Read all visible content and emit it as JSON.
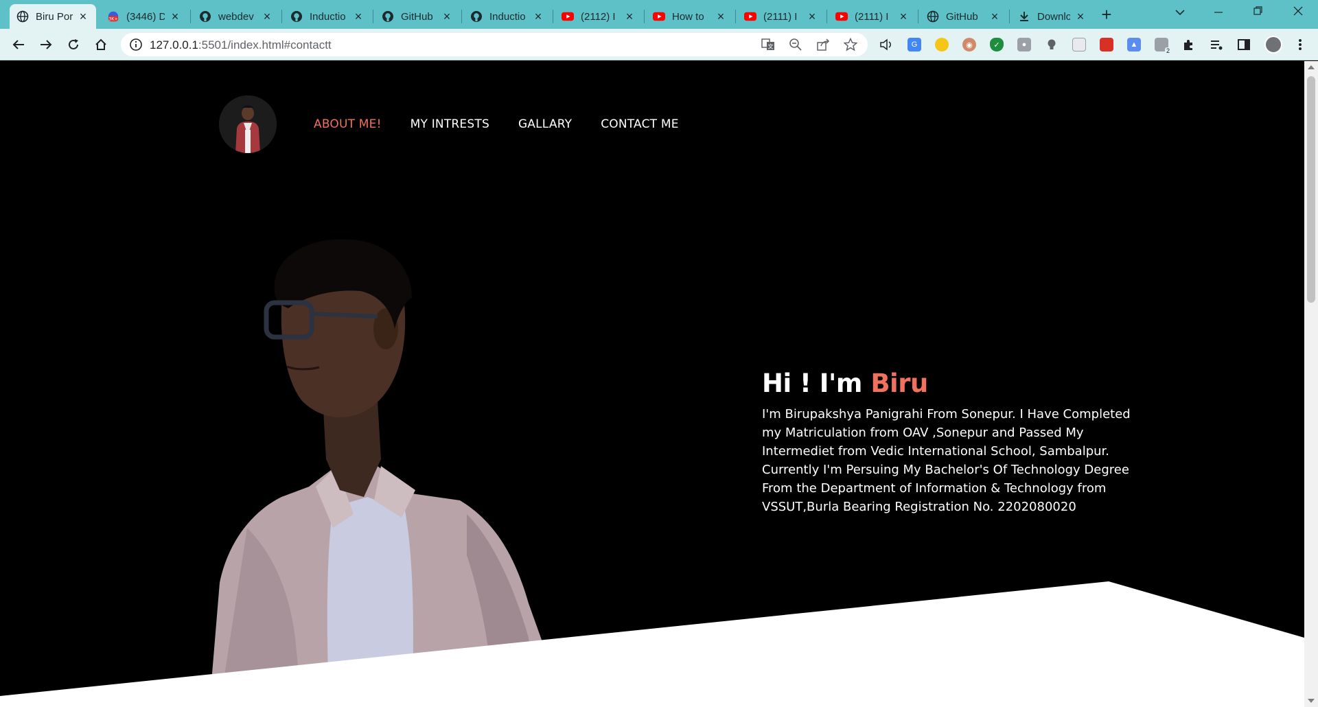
{
  "browser": {
    "tabs": [
      {
        "title": "Biru Por",
        "favicon": "globe-icon",
        "active": true
      },
      {
        "title": "(3446) D",
        "favicon": "notification-badge-icon",
        "badge": "3K+"
      },
      {
        "title": "webdev",
        "favicon": "github-icon"
      },
      {
        "title": "Inductio",
        "favicon": "github-icon"
      },
      {
        "title": "GitHub",
        "favicon": "github-icon"
      },
      {
        "title": "Inductio",
        "favicon": "github-icon"
      },
      {
        "title": "(2112) I",
        "favicon": "youtube-icon"
      },
      {
        "title": "How to",
        "favicon": "youtube-icon"
      },
      {
        "title": "(2111) I",
        "favicon": "youtube-icon"
      },
      {
        "title": "(2111) I",
        "favicon": "youtube-icon"
      },
      {
        "title": "GitHub",
        "favicon": "globe-icon"
      },
      {
        "title": "Downlo",
        "favicon": "download-icon"
      }
    ],
    "url_host": "127.0.0.1",
    "url_rest": ":5501/index.html#contactt",
    "extension_badge": "2",
    "colors": {
      "tabstrip": "#5fc1c8",
      "toolbar": "#e3f3f4",
      "accent": "#f2715c"
    }
  },
  "site": {
    "nav": [
      {
        "label": "ABOUT ME!",
        "active": true
      },
      {
        "label": "MY INTRESTS",
        "active": false
      },
      {
        "label": "GALLARY",
        "active": false
      },
      {
        "label": "CONTACT ME",
        "active": false
      }
    ],
    "hero": {
      "greeting": "Hi ! I'm ",
      "name": "Biru",
      "bio": "I'm Birupakshya Panigrahi From Sonepur. I Have Completed my Matriculation from OAV ,Sonepur and Passed My Intermediet from Vedic International School, Sambalpur. Currently I'm Persuing My Bachelor's Of Technology Degree From the Department of Information & Technology from VSSUT,Burla Bearing Registration No. 2202080020"
    }
  }
}
